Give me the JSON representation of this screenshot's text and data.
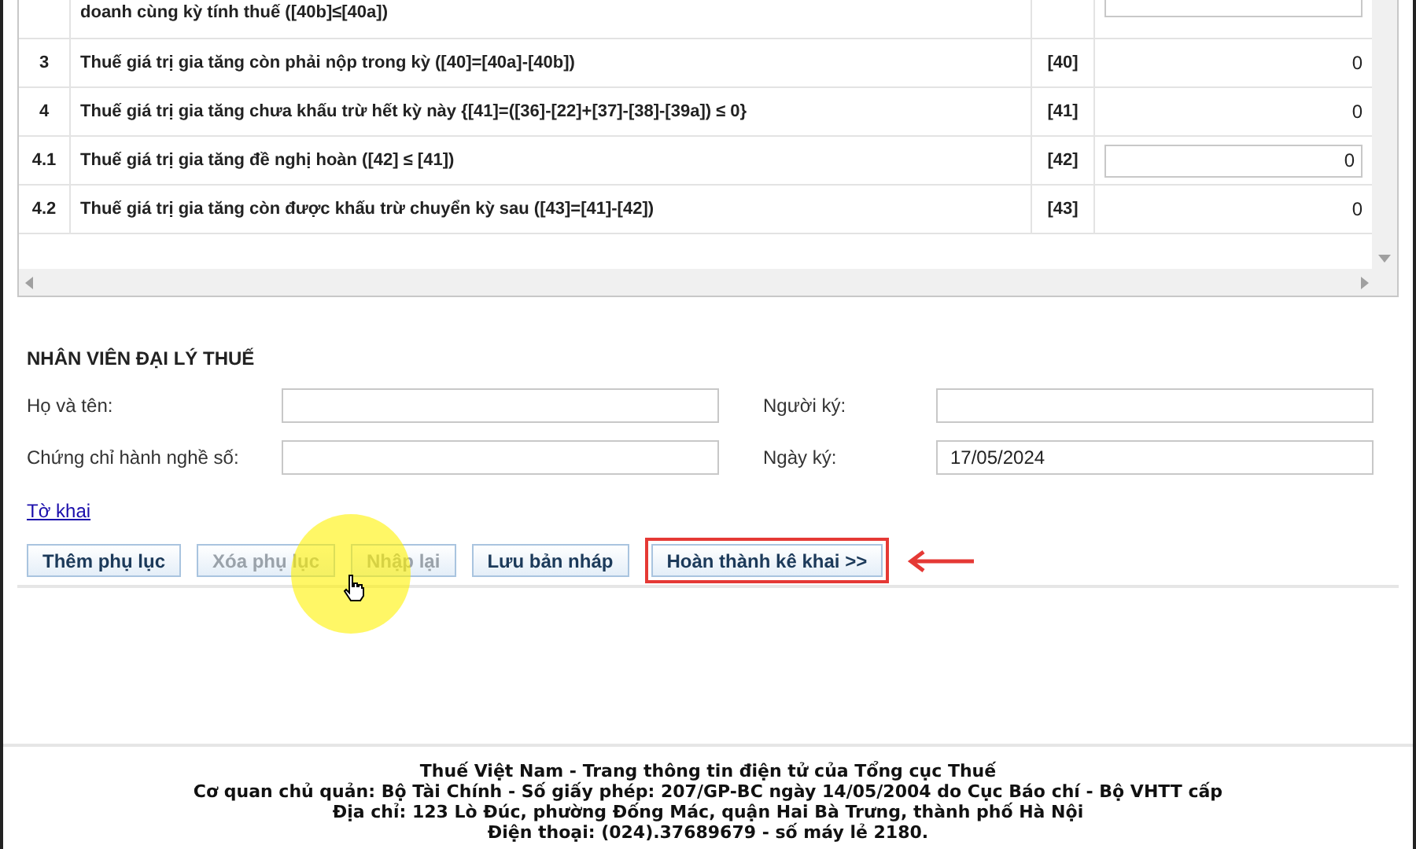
{
  "table": {
    "rows": [
      {
        "stt": "",
        "description": "doanh cùng kỳ tính thuế ([40b]≤[40a])",
        "code": "",
        "value": "",
        "kind": "input"
      },
      {
        "stt": "3",
        "description": "Thuế giá trị gia tăng còn phải nộp trong kỳ ([40]=[40a]-[40b])",
        "code": "[40]",
        "value": "0",
        "kind": "text"
      },
      {
        "stt": "4",
        "description": "Thuế giá trị gia tăng chưa khấu trừ hết kỳ này {[41]=([36]-[22]+[37]-[38]-[39a]) ≤ 0}",
        "code": "[41]",
        "value": "0",
        "kind": "text"
      },
      {
        "stt": "4.1",
        "description": "Thuế giá trị gia tăng đề nghị hoàn ([42] ≤ [41])",
        "code": "[42]",
        "value": "0",
        "kind": "input"
      },
      {
        "stt": "4.2",
        "description": "Thuế giá trị gia tăng còn được khấu trừ chuyển kỳ sau ([43]=[41]-[42])",
        "code": "[43]",
        "value": "0",
        "kind": "text"
      }
    ]
  },
  "agent": {
    "title": "NHÂN VIÊN ĐẠI LÝ THUẾ",
    "fields": [
      {
        "label": "Họ và tên:"
      },
      {
        "label": "Người ký:"
      },
      {
        "label": "Chứng chỉ hành nghề số:"
      },
      {
        "label": "Ngày ký:",
        "value": "17/05/2024"
      }
    ]
  },
  "link": "Tờ khai",
  "buttons": [
    {
      "label": "Thêm phụ lục",
      "disabled": false,
      "highlighted": false
    },
    {
      "label": "Xóa phụ lục",
      "disabled": true,
      "highlighted": false
    },
    {
      "label": "Nhập lại",
      "disabled": true,
      "highlighted": false
    },
    {
      "label": "Lưu bản nháp",
      "disabled": false,
      "highlighted": false
    },
    {
      "label": "Hoàn thành kê khai >>",
      "disabled": false,
      "highlighted": true
    }
  ],
  "footer": [
    "Thuế Việt Nam - Trang thông tin điện tử của Tổng cục Thuế",
    "Cơ quan chủ quản: Bộ Tài Chính - Số giấy phép: 207/GP-BC ngày 14/05/2004 do Cục Báo chí - Bộ VHTT cấp",
    "Địa chỉ: 123 Lò Đúc, phường Đống Mác, quận Hai Bà Trưng, thành phố Hà Nội",
    "Điện thoại: (024).37689679 - số máy lẻ 2180."
  ]
}
